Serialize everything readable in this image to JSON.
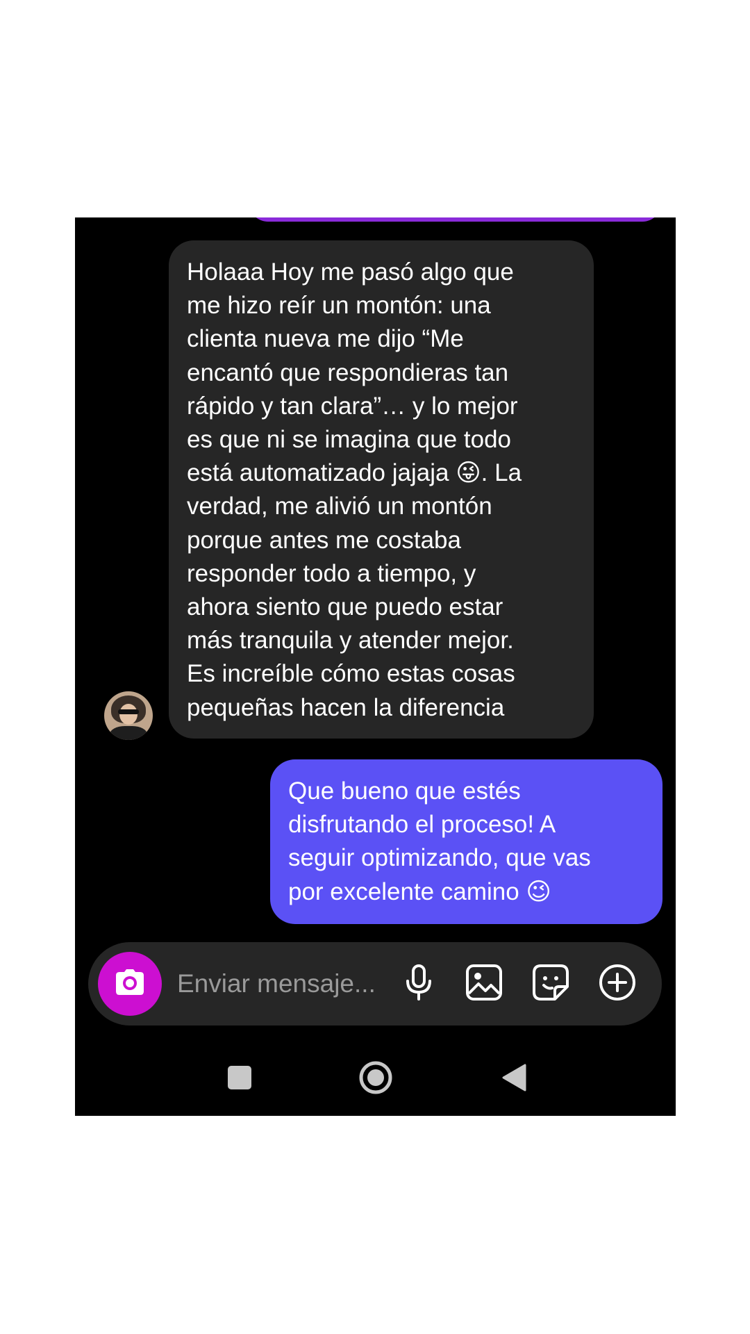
{
  "thread": {
    "incoming_message": {
      "text": "Holaaa Hoy me pasó algo que\nme hizo reír un montón: una\nclienta nueva me dijo “Me\nencantó que respondieras tan\nrápido y tan clara”… y lo mejor\nes que ni se imagina que todo\nestá automatizado jajaja 😜. La\nverdad, me alivió un montón\nporque antes me costaba\nresponder todo a tiempo, y\nahora siento que puedo estar\nmás tranquila y atender mejor.\nEs increíble cómo estas cosas\npequeñas hacen la diferencia"
    },
    "outgoing_message": {
      "text": "Que bueno que estés\ndisfrutando el proceso! A\nseguir optimizando, que vas\npor excelente camino 😉"
    }
  },
  "composer": {
    "placeholder": "Enviar mensaje...",
    "value": "",
    "icons": [
      "camera-icon",
      "microphone-icon",
      "image-icon",
      "sticker-icon",
      "plus-circle-icon"
    ]
  },
  "navigation": {
    "icons": [
      "recents-square-icon",
      "home-circle-icon",
      "back-triangle-icon"
    ]
  },
  "colors": {
    "background": "#000000",
    "incoming_bubble": "#262626",
    "outgoing_bubble": "#5b51f5",
    "camera_button": "#cc0fd1",
    "previous_bubble": "#8a2bd9",
    "text": "#ffffff",
    "placeholder": "#9a9a9a"
  }
}
